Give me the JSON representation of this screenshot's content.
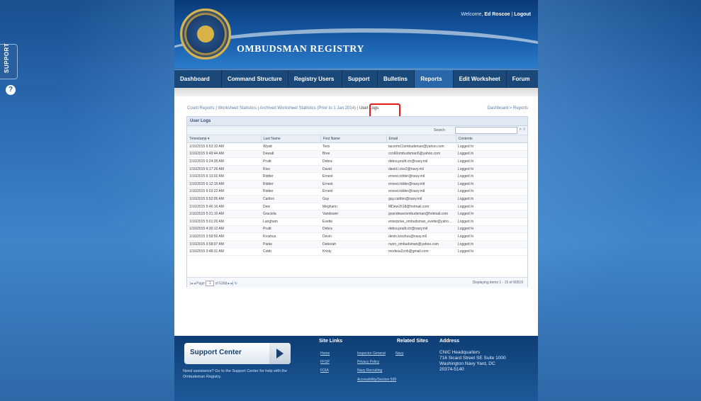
{
  "support_tab": {
    "label": "SUPPORT"
  },
  "header": {
    "welcome_prefix": "Welcome,",
    "user_name": "Ed Roscoe",
    "sep": "|",
    "logout": "Logout",
    "title": "OMBUDSMAN REGISTRY"
  },
  "nav": [
    "Dashboard",
    "Command Structure",
    "Registry Users",
    "Support",
    "Bulletins",
    "Reports",
    "Edit Worksheet",
    "Forum"
  ],
  "subnav": {
    "items": [
      "Count Reports",
      "Worksheet Statistics",
      "Archived Worksheet Statistics (Prior to 1 Jan 2014)",
      "User Logs"
    ],
    "sep": "|"
  },
  "breadcrumb": {
    "parent": "Dashboard",
    "sep": ">",
    "current": "Reports"
  },
  "panel": {
    "title": "User Logs",
    "search_label": "Search",
    "columns": [
      "Timestamp",
      "Last Name",
      "First Name",
      "Email",
      "Contents"
    ],
    "sort_glyph": "▾"
  },
  "rows": [
    [
      "1/16/2015 6:53:10 AM",
      "Wyatt",
      "Tess",
      "tacomn11ombudsman@yahoo.com",
      "Logged In"
    ],
    [
      "1/16/2015 6:49:44 AM",
      "Dewalt",
      "Bree",
      "ccn60ombudsman5@yahoo.com",
      "Logged In"
    ],
    [
      "1/16/2015 6:24:35 AM",
      "Pruitt",
      "Debra",
      "debra.pruitt.ctr@navy.mil",
      "Logged In"
    ],
    [
      "1/16/2015 6:17:26 AM",
      "Rice",
      "David",
      "david.l.rice2@navy.mil",
      "Logged In"
    ],
    [
      "1/16/2015 6:13:02 AM",
      "Ridder",
      "Ernest",
      "ernest.ridder@navy.mil",
      "Logged In"
    ],
    [
      "1/16/2015 6:12:19 AM",
      "Ridder",
      "Ernest",
      "ernest.ridder@navy.mil",
      "Logged In"
    ],
    [
      "1/16/2015 6:03:22 AM",
      "Ridder",
      "Ernest",
      "ernest.ridder@navy.mil",
      "Logged In"
    ],
    [
      "1/16/2015 5:52:05 AM",
      "Carlton",
      "Guy",
      "guy.carlton@navy.mil",
      "Logged In"
    ],
    [
      "1/16/2015 5:46:16 AM",
      "Dew",
      "Meghann",
      "MDew2618@hotmail.com",
      "Logged In"
    ],
    [
      "1/16/2015 5:31:10 AM",
      "Graciela",
      "Vandewer",
      "gvandewerombudsman@hotmail.com",
      "Logged In"
    ],
    [
      "1/16/2015 5:01:20 AM",
      "Langham",
      "Evette",
      "enterprise_ombudsman_evette@yahoo.com",
      "Logged In"
    ],
    [
      "1/16/2015 4:30:12 AM",
      "Pruitt",
      "Debra",
      "debra.pruitt.ctr@navy.mil",
      "Logged In"
    ],
    [
      "1/16/2015 3:59:50 AM",
      "Kroshus",
      "Devin",
      "devin.kroshus@navy.mil",
      "Logged In"
    ],
    [
      "1/16/2015 3:58:07 AM",
      "Parke",
      "Deborah",
      "nunn_ombudsman@yahoo.com",
      "Logged In"
    ],
    [
      "1/16/2015 3:48:31 AM",
      "Cobb",
      "Kristy",
      "modesu2cnb@gmail.com",
      "Logged In"
    ]
  ],
  "pager": {
    "page_label": "Page",
    "page_value": "1",
    "of_label": "of 5368",
    "status": "Displaying items 1 - 15 of 80519"
  },
  "footer": {
    "support_center": "Support Center",
    "support_text": "Need assistance? Go to the Support Center for help with the Ombudsman Registry.",
    "site_links_title": "Site Links",
    "related_title": "Related Sites",
    "address_title": "Address",
    "site_links": [
      "Home",
      "FFSP",
      "FOIA"
    ],
    "related_links": [
      "Inspector General",
      "Navy",
      "Privacy Policy",
      "Navy Recruiting",
      "Accessibility/Section 508"
    ],
    "address": [
      "CNIC Headquarters",
      "716 Sicard Street SE Suite 1000",
      "Washington Navy Yard, DC",
      "20374-5140"
    ]
  }
}
